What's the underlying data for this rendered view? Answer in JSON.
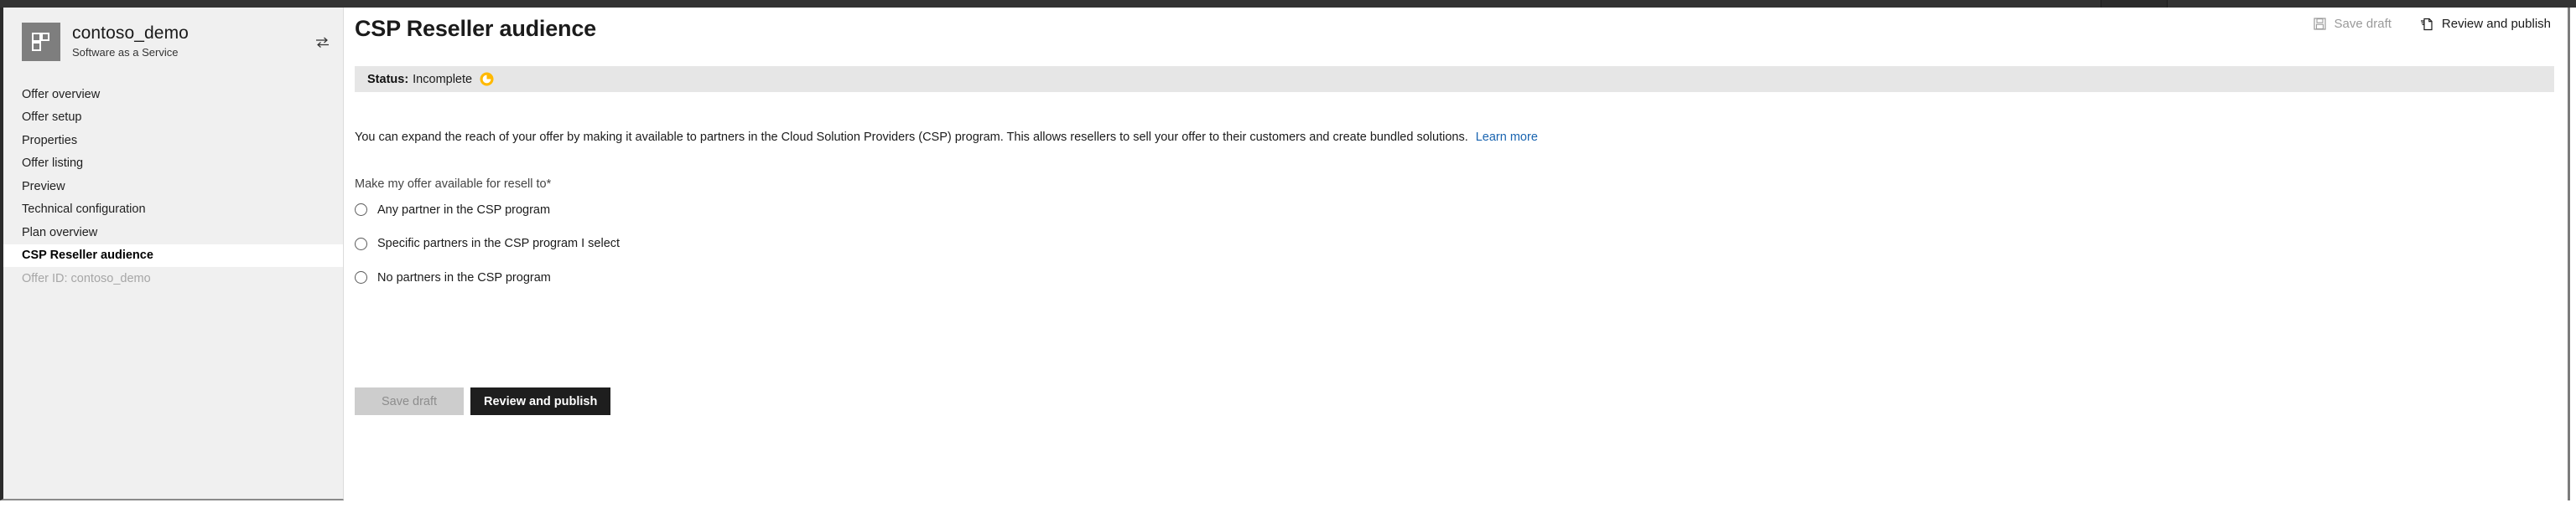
{
  "window": {
    "topbar_segments": 4
  },
  "sidebar": {
    "offer": {
      "name": "contoso_demo",
      "subtitle": "Software as a Service",
      "logo_icon": "offer-tile-icon",
      "switch_icon": "switch-offer-icon"
    },
    "items": [
      {
        "label": "Offer overview",
        "state": "normal"
      },
      {
        "label": "Offer setup",
        "state": "normal"
      },
      {
        "label": "Properties",
        "state": "normal"
      },
      {
        "label": "Offer listing",
        "state": "normal"
      },
      {
        "label": "Preview",
        "state": "normal"
      },
      {
        "label": "Technical configuration",
        "state": "normal"
      },
      {
        "label": "Plan overview",
        "state": "normal"
      },
      {
        "label": "CSP Reseller audience",
        "state": "active"
      },
      {
        "label": "Offer ID: contoso_demo",
        "state": "muted"
      }
    ]
  },
  "header": {
    "title": "CSP Reseller audience",
    "actions": [
      {
        "label": "Save draft",
        "icon": "save-icon",
        "state": "disabled"
      },
      {
        "label": "Review and publish",
        "icon": "publish-icon",
        "state": "enabled"
      }
    ]
  },
  "status": {
    "label": "Status:",
    "value": "Incomplete",
    "icon": "pending-clock-icon",
    "icon_color": "#ffb900"
  },
  "main": {
    "description": "You can expand the reach of your offer by making it available to partners in the Cloud Solution Providers (CSP) program. This allows resellers to sell your offer to their customers and create bundled solutions.",
    "learn_more": "Learn more",
    "field_label": "Make my offer available for resell to",
    "required_marker": "*",
    "options": [
      {
        "label": "Any partner in the CSP program",
        "selected": false
      },
      {
        "label": "Specific partners in the CSP program I select",
        "selected": false
      },
      {
        "label": "No partners in the CSP program",
        "selected": false
      }
    ],
    "buttons": [
      {
        "label": "Save draft",
        "kind": "secondary",
        "state": "disabled"
      },
      {
        "label": "Review and publish",
        "kind": "primary",
        "state": "enabled"
      }
    ]
  },
  "colors": {
    "accent_link": "#1964b0",
    "status_amber": "#ffb900",
    "primary_button": "#1e1e1e",
    "chrome_dark": "#333333"
  }
}
